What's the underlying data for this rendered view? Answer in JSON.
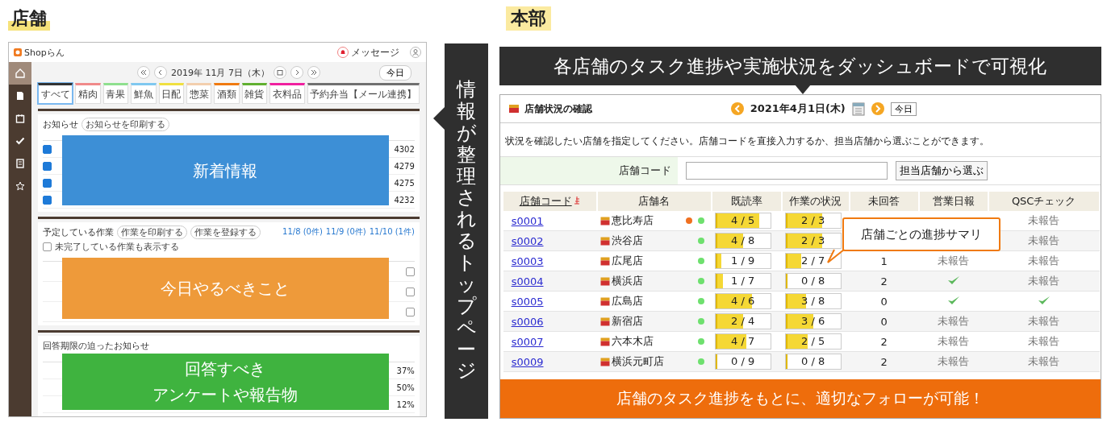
{
  "store_side": {
    "heading": "店舗",
    "app": {
      "logo": "Shopらん",
      "message_label": "メッセージ",
      "date": "2019年 11月 7日（木）",
      "today_button": "今日",
      "tabs": [
        {
          "label": "すべて",
          "selected": true,
          "color": "#333333"
        },
        {
          "label": "精肉",
          "selected": false,
          "color": "#f08a8a"
        },
        {
          "label": "青果",
          "selected": false,
          "color": "#8fe08f"
        },
        {
          "label": "鮮魚",
          "selected": false,
          "color": "#7fc8f0"
        },
        {
          "label": "日配",
          "selected": false,
          "color": "#f0e040"
        },
        {
          "label": "惣菜",
          "selected": false,
          "color": "#f3cfae"
        },
        {
          "label": "酒類",
          "selected": false,
          "color": "#f07a10"
        },
        {
          "label": "雑貨",
          "selected": false,
          "color": "#60b030"
        },
        {
          "label": "衣料品",
          "selected": false,
          "color": "#f020a0"
        },
        {
          "label": "予約弁当【メール連携】",
          "selected": false,
          "color": "#707070"
        }
      ],
      "notices": {
        "title": "お知らせ",
        "print_button": "お知らせを印刷する",
        "rows": [
          {
            "checked": true,
            "no": "4302"
          },
          {
            "checked": true,
            "no": "4279"
          },
          {
            "checked": true,
            "no": "4275"
          },
          {
            "checked": true,
            "no": "4232"
          }
        ]
      },
      "tasks": {
        "title": "予定している作業",
        "buttons": [
          "作業を印刷する",
          "作業を登録する"
        ],
        "days": [
          "11/8 (0件)",
          "11/9 (0件)",
          "11/10 (1件)"
        ],
        "show_done": {
          "label": "未完了している作業も表示する",
          "checked": false
        },
        "rows": [
          {
            "done": false
          },
          {
            "done": false
          },
          {
            "done": false
          }
        ]
      },
      "answers": {
        "title": "回答期限の迫ったお知らせ",
        "rows": [
          {
            "rate": "37%"
          },
          {
            "rate": "50%"
          },
          {
            "rate": "12%"
          }
        ]
      }
    },
    "overlays": [
      {
        "color": "#3d8fd6",
        "lines": [
          "新着情報"
        ]
      },
      {
        "color": "#ee9a3a",
        "lines": [
          "今日やるべきこと"
        ]
      },
      {
        "color": "#3fb33f",
        "lines": [
          "回答すべき",
          "アンケートや報告物"
        ]
      }
    ],
    "caption": "情報が整理されるトップページ"
  },
  "hq_side": {
    "heading": "本部",
    "banner": "各店舗のタスク進捗や実施状況をダッシュボードで可視化",
    "panel": {
      "title": "店舗状況の確認",
      "date": "2021年4月1日(木)",
      "today_button": "今日",
      "instruction": "状況を確認したい店舗を指定してください。店舗コードを直接入力するか、担当店舗から選ぶことができます。",
      "code_label": "店舗コード",
      "choose_button": "担当店舗から選ぶ",
      "columns": [
        "店舗コード",
        "店舗名",
        "既読率",
        "作業の状況",
        "未回答",
        "営業日報",
        "QSCチェック"
      ],
      "rows": [
        {
          "code": "s0001",
          "name": "恵比寿店",
          "dots": [
            {
              "color": "#f07020"
            },
            {
              "color": "#6ee06e"
            }
          ],
          "read": {
            "level": 0.8,
            "text": "4 / 5"
          },
          "work": {
            "level": 0.67,
            "text": "2 / 3"
          },
          "qsc": {
            "kind": "text",
            "text": "未報告"
          }
        },
        {
          "code": "s0002",
          "name": "渋谷店",
          "dots": [
            {
              "color": "#6ee06e"
            }
          ],
          "read": {
            "level": 0.5,
            "text": "4 / 8"
          },
          "work": {
            "level": 0.67,
            "text": "2 / 3"
          },
          "qsc": {
            "kind": "text",
            "text": "未報告"
          }
        },
        {
          "code": "s0003",
          "name": "広尾店",
          "dots": [
            {
              "color": "#6ee06e"
            }
          ],
          "read": {
            "level": 0.11,
            "text": "1 / 9"
          },
          "work": {
            "level": 0.29,
            "text": "2 / 7"
          },
          "unanswered": "1",
          "daily": {
            "kind": "text",
            "text": "未報告"
          },
          "qsc": {
            "kind": "text",
            "text": "未報告"
          }
        },
        {
          "code": "s0004",
          "name": "横浜店",
          "dots": [
            {
              "color": "#6ee06e"
            }
          ],
          "read": {
            "level": 0.14,
            "text": "1 / 7"
          },
          "work": {
            "level": 0,
            "text": "0 / 8"
          },
          "unanswered": "2",
          "daily": {
            "kind": "check"
          },
          "qsc": {
            "kind": "text",
            "text": "未報告"
          }
        },
        {
          "code": "s0005",
          "name": "広島店",
          "dots": [
            {
              "color": "#6ee06e"
            }
          ],
          "read": {
            "level": 0.67,
            "text": "4 / 6"
          },
          "work": {
            "level": 0.375,
            "text": "3 / 8"
          },
          "unanswered": "0",
          "daily": {
            "kind": "check"
          },
          "qsc": {
            "kind": "check"
          }
        },
        {
          "code": "s0006",
          "name": "新宿店",
          "dots": [
            {
              "color": "#6ee06e"
            }
          ],
          "read": {
            "level": 0.5,
            "text": "2 / 4"
          },
          "work": {
            "level": 0.5,
            "text": "3 / 6"
          },
          "unanswered": "0",
          "daily": {
            "kind": "text",
            "text": "未報告"
          },
          "qsc": {
            "kind": "text",
            "text": "未報告"
          }
        },
        {
          "code": "s0007",
          "name": "六本木店",
          "dots": [
            {
              "color": "#6ee06e"
            }
          ],
          "read": {
            "level": 0.57,
            "text": "4 / 7"
          },
          "work": {
            "level": 0.4,
            "text": "2 / 5"
          },
          "unanswered": "2",
          "daily": {
            "kind": "text",
            "text": "未報告"
          },
          "qsc": {
            "kind": "text",
            "text": "未報告"
          }
        },
        {
          "code": "s0009",
          "name": "横浜元町店",
          "dots": [
            {
              "color": "#6ee06e"
            }
          ],
          "read": {
            "level": 0,
            "text": "0 / 9"
          },
          "work": {
            "level": 0,
            "text": "0 / 8"
          },
          "unanswered": "2",
          "daily": {
            "kind": "text",
            "text": "未報告"
          },
          "qsc": {
            "kind": "text",
            "text": "未報告"
          }
        }
      ]
    },
    "callout": "店舗ごとの進捗サマリ",
    "footer_banner": "店舗のタスク進捗をもとに、適切なフォローが可能！"
  }
}
